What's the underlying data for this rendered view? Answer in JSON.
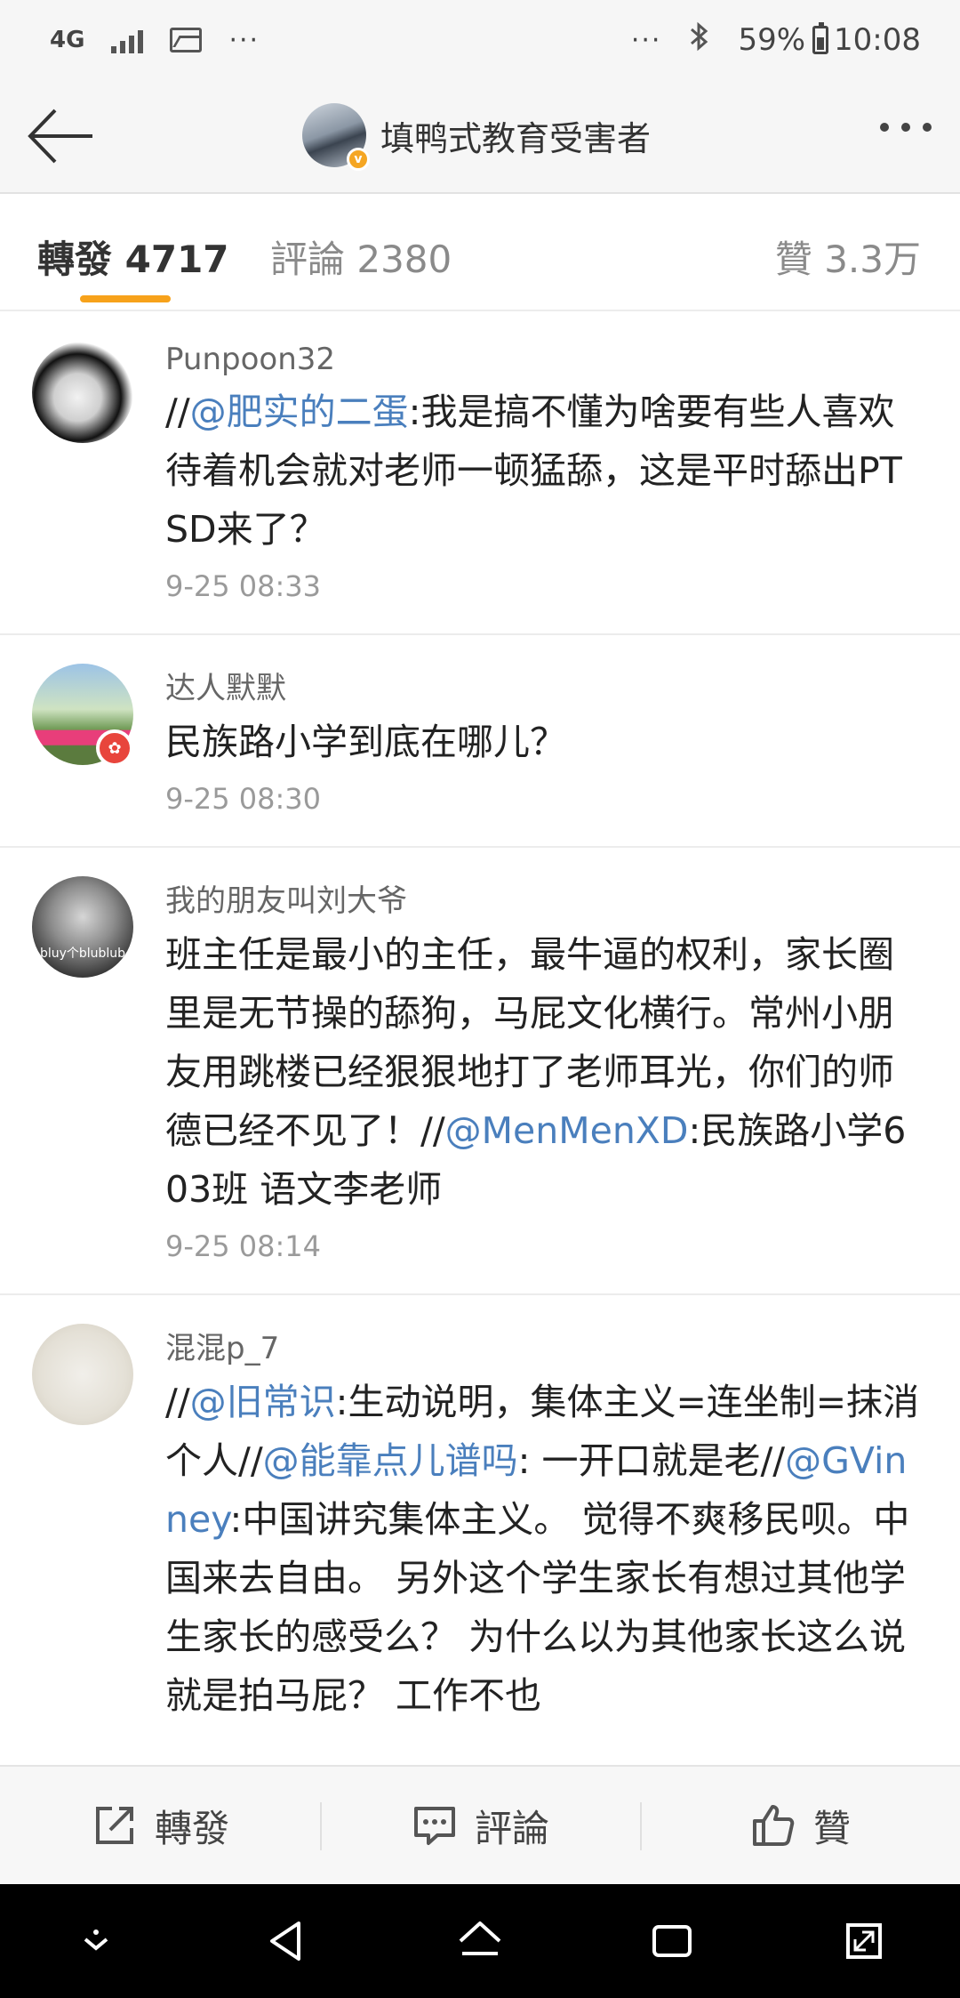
{
  "status_bar": {
    "network": "4G",
    "battery": "59%",
    "time": "10:08",
    "icons": [
      "signal-icon",
      "image-icon",
      "more-dots-icon",
      "bluetooth-icon",
      "battery-icon"
    ]
  },
  "header": {
    "title": "填鸭式教育受害者",
    "verified_badge": "v"
  },
  "tabs": {
    "repost": "轉發 4717",
    "comment": "評論 2380",
    "like": "贊 3.3万",
    "active_color": "#f7a21b"
  },
  "feed": [
    {
      "user": "Punpoon32",
      "segments": [
        {
          "t": "//",
          "link": false
        },
        {
          "t": "@肥实的二蛋",
          "link": true
        },
        {
          "t": ":我是搞不懂为啥要有些人喜欢待着机会就对老师一顿猛舔，这是平时舔出PTSD来了？",
          "link": false
        }
      ],
      "time": "9-25 08:33"
    },
    {
      "user": "达人默默",
      "segments": [
        {
          "t": "民族路小学到底在哪儿？",
          "link": false
        }
      ],
      "time": "9-25 08:30"
    },
    {
      "user": "我的朋友叫刘大爷",
      "avatar_text": "bluу个blublub",
      "segments": [
        {
          "t": "班主任是最小的主任，最牛逼的权利，家长圈里是无节操的舔狗，马屁文化横行。常州小朋友用跳楼已经狠狠地打了老师耳光，你们的师德已经不见了！//",
          "link": false
        },
        {
          "t": "@MenMenXD",
          "link": true
        },
        {
          "t": ":民族路小学603班 语文李老师",
          "link": false
        }
      ],
      "time": "9-25 08:14"
    },
    {
      "user": "混混p_7",
      "segments": [
        {
          "t": "//",
          "link": false
        },
        {
          "t": "@旧常识",
          "link": true
        },
        {
          "t": ":生动说明，集体主义=连坐制=抹消个人//",
          "link": false
        },
        {
          "t": "@能靠点儿谱吗",
          "link": true
        },
        {
          "t": ": 一开口就是老//",
          "link": false
        },
        {
          "t": "@GVinney",
          "link": true
        },
        {
          "t": ":中国讲究集体主义。 觉得不爽移民呗。中国来去自由。 另外这个学生家长有想过其他学生家长的感受么？ 为什么以为其他家长这么说就是拍马屁？ 工作不也",
          "link": false
        }
      ],
      "time": ""
    }
  ],
  "actions": {
    "repost": "轉發",
    "comment": "評論",
    "like": "贊"
  },
  "colors": {
    "link": "#4a7fbd",
    "accent": "#f7a21b"
  }
}
